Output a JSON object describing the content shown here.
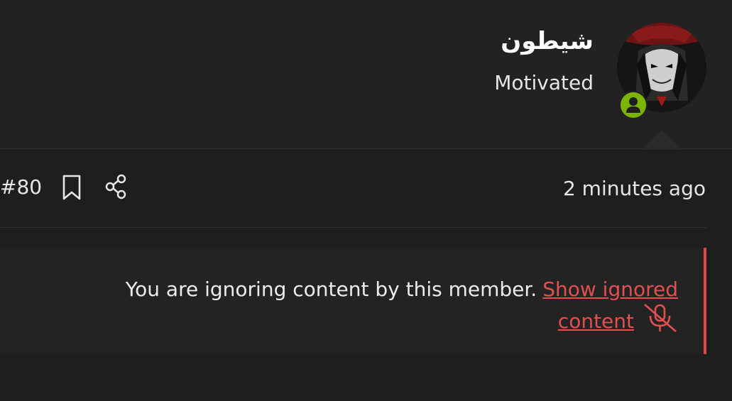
{
  "user": {
    "name": "شيطون",
    "title": "Motivated",
    "status": "online"
  },
  "post": {
    "number": "#80",
    "time": "2 minutes ago"
  },
  "ignored": {
    "message": "You are ignoring content by this member.",
    "link_label": "Show ignored content"
  },
  "icons": {
    "bookmark": "bookmark-icon",
    "share": "share-icon",
    "mute": "microphone-off-icon",
    "online": "user-icon"
  },
  "colors": {
    "accent": "#e05050",
    "online": "#7cb500",
    "background": "#1e1e1e"
  }
}
